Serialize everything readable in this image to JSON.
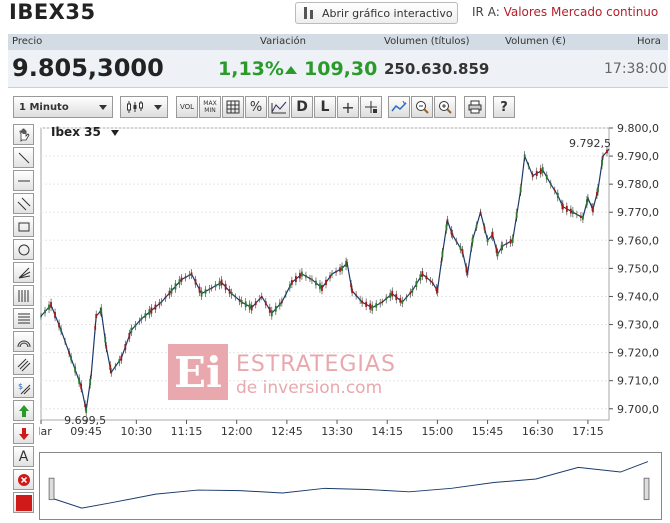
{
  "page": {
    "title": "IBEX35",
    "interactive_button": "Abrir gráfico interactivo",
    "goto_label": "IR A:",
    "goto_value": "Valores Mercado continuo"
  },
  "quote": {
    "headers": {
      "price": "Precio",
      "variation": "Variación",
      "volume_titles": "Volumen (títulos)",
      "volume_eur": "Volumen (€)",
      "time": "Hora"
    },
    "price": "9.805,3000",
    "var_pct": "1,13%",
    "var_abs": "109,30",
    "volume": "250.630.859",
    "time": "17:38:00"
  },
  "toolbar": {
    "interval": "1 Minuto",
    "vol": "VOL",
    "maxmin": "MAX MIN",
    "pct": "%",
    "d": "D",
    "l": "L",
    "plus": "+",
    "help": "?"
  },
  "sidebar": {
    "text_tool": "A"
  },
  "chart_data": {
    "type": "line",
    "title": "Ibex 35",
    "x_labels": [
      "Mar",
      "09:45",
      "10:30",
      "11:15",
      "12:00",
      "12:45",
      "13:30",
      "14:15",
      "15:00",
      "15:45",
      "16:30",
      "17:15"
    ],
    "y_ticks": [
      "9.800,0",
      "9.790,0",
      "9.780,0",
      "9.770,0",
      "9.760,0",
      "9.750,0",
      "9.740,0",
      "9.730,0",
      "9.720,0",
      "9.710,0",
      "9.700,0"
    ],
    "ylim": [
      9696,
      9800
    ],
    "annotations": {
      "high": "9.792,5",
      "low": "9.699,5"
    },
    "points": [
      [
        0,
        9733
      ],
      [
        10,
        9737
      ],
      [
        20,
        9728
      ],
      [
        30,
        9718
      ],
      [
        40,
        9708
      ],
      [
        45,
        9699.5
      ],
      [
        50,
        9712
      ],
      [
        55,
        9733
      ],
      [
        60,
        9735
      ],
      [
        65,
        9722
      ],
      [
        70,
        9713
      ],
      [
        80,
        9718
      ],
      [
        90,
        9728
      ],
      [
        100,
        9732
      ],
      [
        110,
        9735
      ],
      [
        120,
        9738
      ],
      [
        130,
        9742
      ],
      [
        140,
        9746
      ],
      [
        150,
        9748
      ],
      [
        160,
        9741
      ],
      [
        170,
        9743
      ],
      [
        180,
        9745
      ],
      [
        190,
        9741
      ],
      [
        200,
        9738
      ],
      [
        210,
        9736
      ],
      [
        220,
        9740
      ],
      [
        230,
        9734
      ],
      [
        240,
        9738
      ],
      [
        250,
        9745
      ],
      [
        260,
        9748
      ],
      [
        270,
        9746
      ],
      [
        280,
        9743
      ],
      [
        290,
        9748
      ],
      [
        300,
        9750
      ],
      [
        305,
        9752
      ],
      [
        310,
        9742
      ],
      [
        320,
        9738
      ],
      [
        330,
        9736
      ],
      [
        340,
        9738
      ],
      [
        350,
        9741
      ],
      [
        360,
        9738
      ],
      [
        370,
        9742
      ],
      [
        380,
        9748
      ],
      [
        390,
        9745
      ],
      [
        395,
        9742
      ],
      [
        400,
        9755
      ],
      [
        405,
        9767
      ],
      [
        410,
        9762
      ],
      [
        420,
        9756
      ],
      [
        425,
        9748
      ],
      [
        430,
        9760
      ],
      [
        438,
        9770
      ],
      [
        445,
        9760
      ],
      [
        450,
        9762
      ],
      [
        455,
        9755
      ],
      [
        460,
        9758
      ],
      [
        470,
        9760
      ],
      [
        478,
        9778
      ],
      [
        482,
        9790
      ],
      [
        490,
        9783
      ],
      [
        500,
        9785
      ],
      [
        508,
        9780
      ],
      [
        515,
        9776
      ],
      [
        520,
        9772
      ],
      [
        530,
        9770
      ],
      [
        540,
        9768
      ],
      [
        545,
        9775
      ],
      [
        550,
        9771
      ],
      [
        555,
        9778
      ],
      [
        560,
        9790
      ],
      [
        566,
        9792.5
      ]
    ],
    "nav_points": [
      [
        0,
        9730
      ],
      [
        30,
        9712
      ],
      [
        60,
        9722
      ],
      [
        100,
        9736
      ],
      [
        140,
        9743
      ],
      [
        180,
        9742
      ],
      [
        220,
        9738
      ],
      [
        260,
        9746
      ],
      [
        300,
        9744
      ],
      [
        340,
        9740
      ],
      [
        380,
        9746
      ],
      [
        420,
        9756
      ],
      [
        460,
        9762
      ],
      [
        500,
        9782
      ],
      [
        540,
        9774
      ],
      [
        566,
        9792
      ]
    ]
  },
  "watermark": {
    "logo": "Ei",
    "line1": "ESTRATEGIAS",
    "line2": "de inversion.com"
  }
}
